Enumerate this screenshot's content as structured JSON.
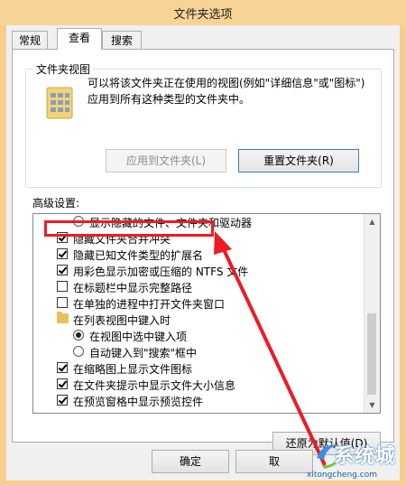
{
  "window": {
    "title": "文件夹选项"
  },
  "tabs": [
    {
      "label": "常规"
    },
    {
      "label": "查看"
    },
    {
      "label": "搜索"
    }
  ],
  "folder_views": {
    "legend": "文件夹视图",
    "description": "可以将该文件夹正在使用的视图(例如\"详细信息\"或\"图标\")应用到所有这种类型的文件夹中。",
    "apply_button": "应用到文件夹(L)",
    "reset_button": "重置文件夹(R)"
  },
  "advanced": {
    "label": "高级设置:",
    "items": [
      {
        "kind": "radio",
        "checked": false,
        "label": "显示隐藏的文件、文件夹和驱动器"
      },
      {
        "kind": "checkbox",
        "checked": true,
        "label": "隐藏文件夹合并冲突"
      },
      {
        "kind": "checkbox",
        "checked": true,
        "label": "隐藏已知文件类型的扩展名"
      },
      {
        "kind": "checkbox",
        "checked": true,
        "label": "用彩色显示加密或压缩的 NTFS 文件"
      },
      {
        "kind": "checkbox",
        "checked": false,
        "label": "在标题栏中显示完整路径"
      },
      {
        "kind": "checkbox",
        "checked": false,
        "label": "在单独的进程中打开文件夹窗口"
      },
      {
        "kind": "folder",
        "label": "在列表视图中键入时"
      },
      {
        "kind": "radio",
        "checked": true,
        "label": "在视图中选中键入项"
      },
      {
        "kind": "radio",
        "checked": false,
        "label": "自动键入到\"搜索\"框中"
      },
      {
        "kind": "checkbox",
        "checked": true,
        "label": "在缩略图上显示文件图标"
      },
      {
        "kind": "checkbox",
        "checked": true,
        "label": "在文件夹提示中显示文件大小信息"
      },
      {
        "kind": "checkbox",
        "checked": true,
        "label": "在预览窗格中显示预览控件"
      }
    ],
    "restore_button": "还原为默认值(D)"
  },
  "footer": {
    "ok_button": "确定",
    "cancel_button": "取"
  },
  "watermark": {
    "brand": "系统城",
    "url": "xitongcheng.com"
  },
  "colors": {
    "highlight": "#ec1c24",
    "title_bar": "#f7d496"
  }
}
